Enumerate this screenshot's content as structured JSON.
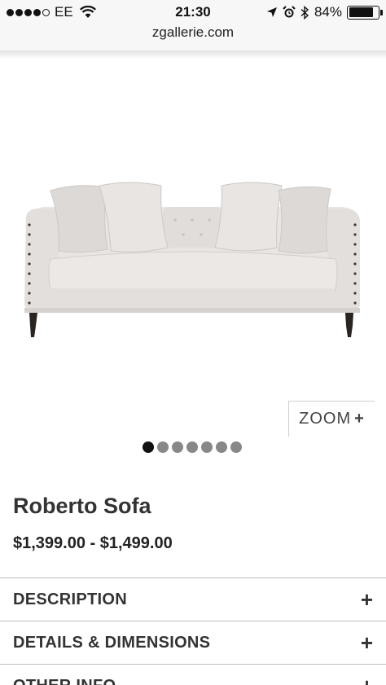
{
  "status_bar": {
    "carrier": "EE",
    "time": "21:30",
    "battery": "84%",
    "battery_level": 0.84,
    "signal_bars_filled": 4,
    "signal_bars_total": 5
  },
  "browser": {
    "url": "zgallerie.com"
  },
  "gallery": {
    "image_icon": "sofa-image",
    "zoom_label": "ZOOM",
    "zoom_icon": "+",
    "total_images": 7,
    "active_index": 0
  },
  "product": {
    "title": "Roberto Sofa",
    "price": "$1,399.00 - $1,499.00"
  },
  "accordion": [
    {
      "label": "DESCRIPTION",
      "icon": "+"
    },
    {
      "label": "DETAILS & DIMENSIONS",
      "icon": "+"
    },
    {
      "label": "OTHER INFO",
      "icon": "+"
    }
  ],
  "colors": {
    "sofa": "#e6e2e0",
    "text": "#333333",
    "pager_active": "#111111",
    "pager_inactive": "#888888"
  }
}
